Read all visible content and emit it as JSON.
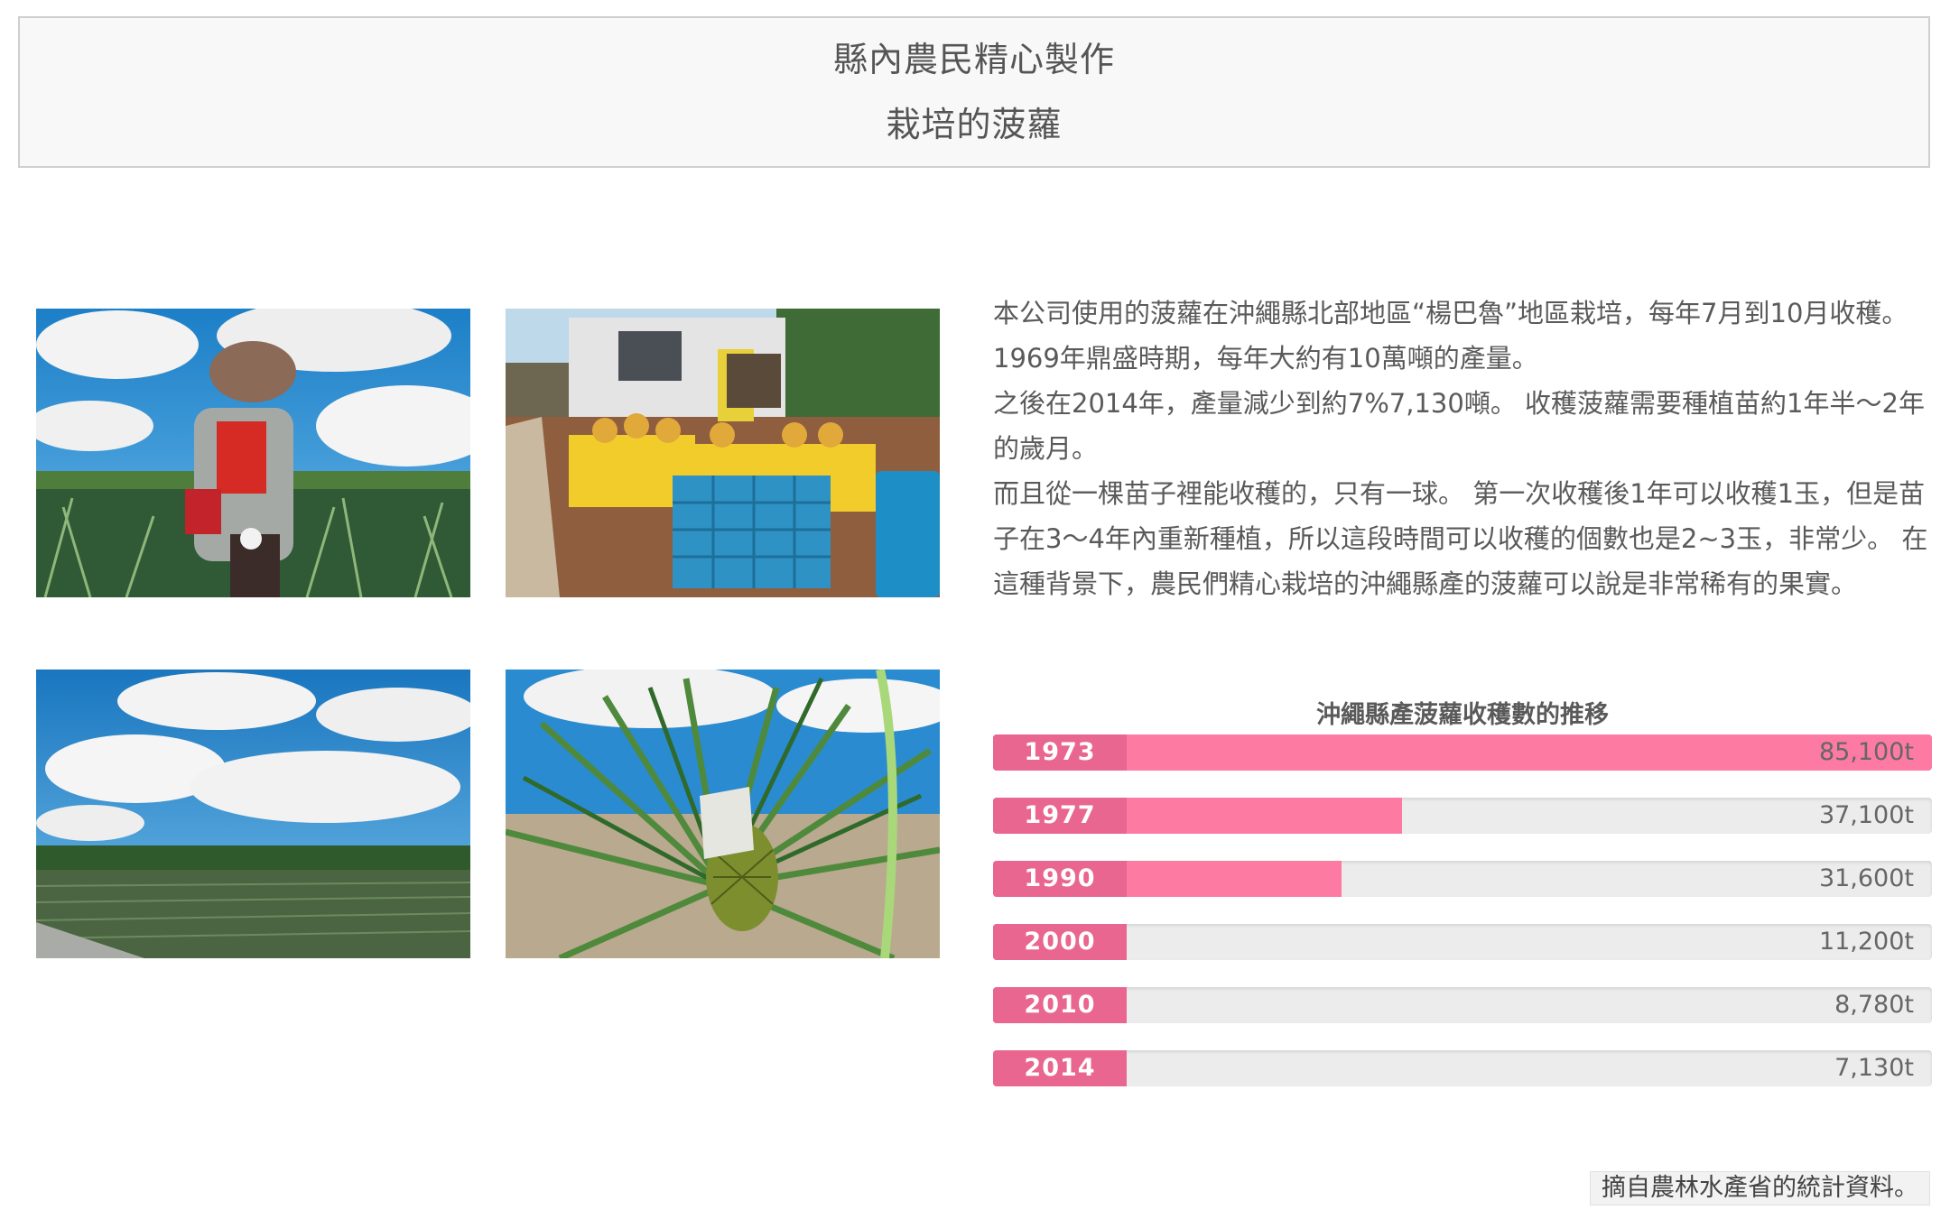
{
  "header": {
    "line1": "縣內農民精心製作",
    "line2": "栽培的菠蘿"
  },
  "intro": {
    "paragraphs": [
      "本公司使用的菠蘿在沖繩縣北部地區“楊巴魯”地區栽培，每年7月到10月收穫。",
      "1969年鼎盛時期，每年大約有10萬噸的產量。",
      "之後在2014年，產量減少到約7%7,130噸。 收穫菠蘿需要種植苗約1年半〜2年的歲月。",
      "而且從一棵苗子裡能收穫的，只有一球。 第一次收穫後1年可以收穫1玉，但是苗子在3〜4年內重新種植，所以這段時間可以收穫的個數也是2~3玉，非常少。 在這種背景下，農民們精心栽培的沖繩縣產的菠蘿可以說是非常稀有的果實。"
    ]
  },
  "chart_data": {
    "type": "bar",
    "orientation": "horizontal",
    "title": "沖繩縣產菠蘿收穫數的推移",
    "categories": [
      "1973",
      "1977",
      "1990",
      "2000",
      "2010",
      "2014"
    ],
    "values": [
      85100,
      37100,
      31600,
      11200,
      8780,
      7130
    ],
    "value_labels": [
      "85,100t",
      "37,100t",
      "31,600t",
      "11,200t",
      "8,780t",
      "7,130t"
    ],
    "xlim": [
      0,
      85100
    ],
    "colors": {
      "fill": "#fd7aa3",
      "label_bg": "#e86690",
      "track": "#ececec"
    }
  },
  "source_note": "摘自農林水產省的統計資料。"
}
